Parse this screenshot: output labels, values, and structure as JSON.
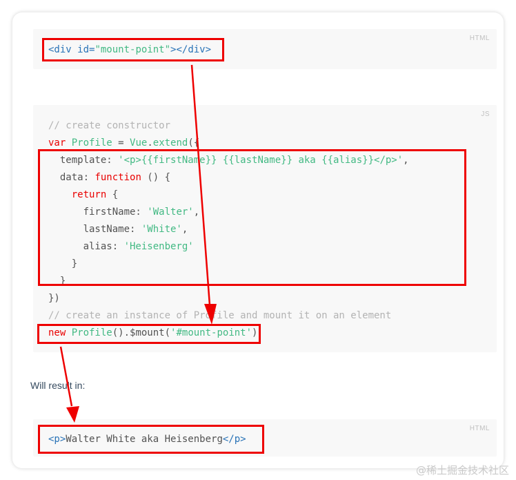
{
  "code_block_1": {
    "lang": "HTML",
    "line": [
      {
        "t": "<div ",
        "c": "tag"
      },
      {
        "t": "id=",
        "c": "tag"
      },
      {
        "t": "\"mount-point\"",
        "c": "str"
      },
      {
        "t": "></div>",
        "c": "tag"
      }
    ]
  },
  "code_block_2": {
    "lang": "JS",
    "lines": [
      [
        {
          "t": "// create constructor",
          "c": "cm"
        }
      ],
      [
        {
          "t": "var ",
          "c": "kw"
        },
        {
          "t": "Profile",
          "c": "fn"
        },
        {
          "t": " = ",
          "c": "plain"
        },
        {
          "t": "Vue",
          "c": "fn"
        },
        {
          "t": ".",
          "c": "plain"
        },
        {
          "t": "extend",
          "c": "fn"
        },
        {
          "t": "({",
          "c": "plain"
        }
      ],
      [
        {
          "t": "  template: ",
          "c": "plain"
        },
        {
          "t": "'<p>{{firstName}} {{lastName}} aka {{alias}}</p>'",
          "c": "str"
        },
        {
          "t": ",",
          "c": "plain"
        }
      ],
      [
        {
          "t": "  data: ",
          "c": "plain"
        },
        {
          "t": "function",
          "c": "kw"
        },
        {
          "t": " () {",
          "c": "plain"
        }
      ],
      [
        {
          "t": "    ",
          "c": "plain"
        },
        {
          "t": "return",
          "c": "kw"
        },
        {
          "t": " {",
          "c": "plain"
        }
      ],
      [
        {
          "t": "      firstName: ",
          "c": "plain"
        },
        {
          "t": "'Walter'",
          "c": "str"
        },
        {
          "t": ",",
          "c": "plain"
        }
      ],
      [
        {
          "t": "      lastName: ",
          "c": "plain"
        },
        {
          "t": "'White'",
          "c": "str"
        },
        {
          "t": ",",
          "c": "plain"
        }
      ],
      [
        {
          "t": "      alias: ",
          "c": "plain"
        },
        {
          "t": "'Heisenberg'",
          "c": "str"
        }
      ],
      [
        {
          "t": "    }",
          "c": "plain"
        }
      ],
      [
        {
          "t": "  }",
          "c": "plain"
        }
      ],
      [
        {
          "t": "})",
          "c": "plain"
        }
      ],
      [
        {
          "t": "// create an instance of Profile and mount it on an element",
          "c": "cm"
        }
      ],
      [
        {
          "t": "new ",
          "c": "kw"
        },
        {
          "t": "Profile",
          "c": "fn"
        },
        {
          "t": "().$mount(",
          "c": "plain"
        },
        {
          "t": "'#mount-point'",
          "c": "str"
        },
        {
          "t": ")",
          "c": "plain"
        }
      ]
    ]
  },
  "prose_text": "Will result in:",
  "code_block_3": {
    "lang": "HTML",
    "line": [
      {
        "t": "<p>",
        "c": "tag"
      },
      {
        "t": "Walter White aka Heisenberg",
        "c": "plain"
      },
      {
        "t": "</p>",
        "c": "tag"
      }
    ]
  },
  "colors": {
    "annotation_red": "#ee0000",
    "keyword": "#e90000",
    "string": "#42b983",
    "tag": "#2973b7",
    "comment": "#b3b3b3"
  },
  "watermark": "@稀土掘金技术社区"
}
